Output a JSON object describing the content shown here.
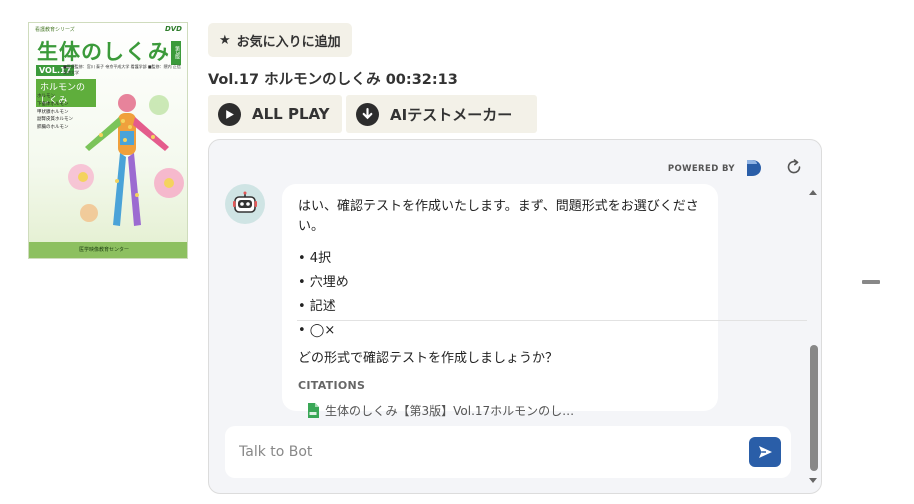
{
  "cover": {
    "series": "看護教育シリーズ",
    "dvd": "DVD",
    "title": "生体のしくみ",
    "edition": "第3版",
    "vol": "VOL.17",
    "authors": "■医療監修：宮川 泰子 帝京平成大学 看護学部 ■監修：隈内 正信 東京大学",
    "subtitle": "ホルモンのしくみ",
    "chapters": [
      "ホルモン",
      "下垂体ホルモン",
      "甲状腺ホルモン",
      "副腎皮質ホルモン",
      "膵臓のホルモン"
    ],
    "publisher": "医学映像教育センター"
  },
  "favorite_label": "お気に入りに追加",
  "video_title": "Vol.17 ホルモンのしくみ 00:32:13",
  "buttons": {
    "all_play": "ALL PLAY",
    "ai_test": "AIテストメーカー"
  },
  "chat": {
    "powered_by": "POWERED BY",
    "message_intro": "はい、確認テストを作成いたします。まず、問題形式をお選びください。",
    "options": [
      "• 4択",
      "• 穴埋め",
      "• 記述",
      "• ◯×"
    ],
    "question": "どの形式で確認テストを作成しましょうか？",
    "citations_label": "CITATIONS",
    "citation_item": "生体のしくみ【第3版】Vol.17ホルモンのし…",
    "input_placeholder": "Talk to Bot",
    "accent": "#2a5ea8"
  }
}
